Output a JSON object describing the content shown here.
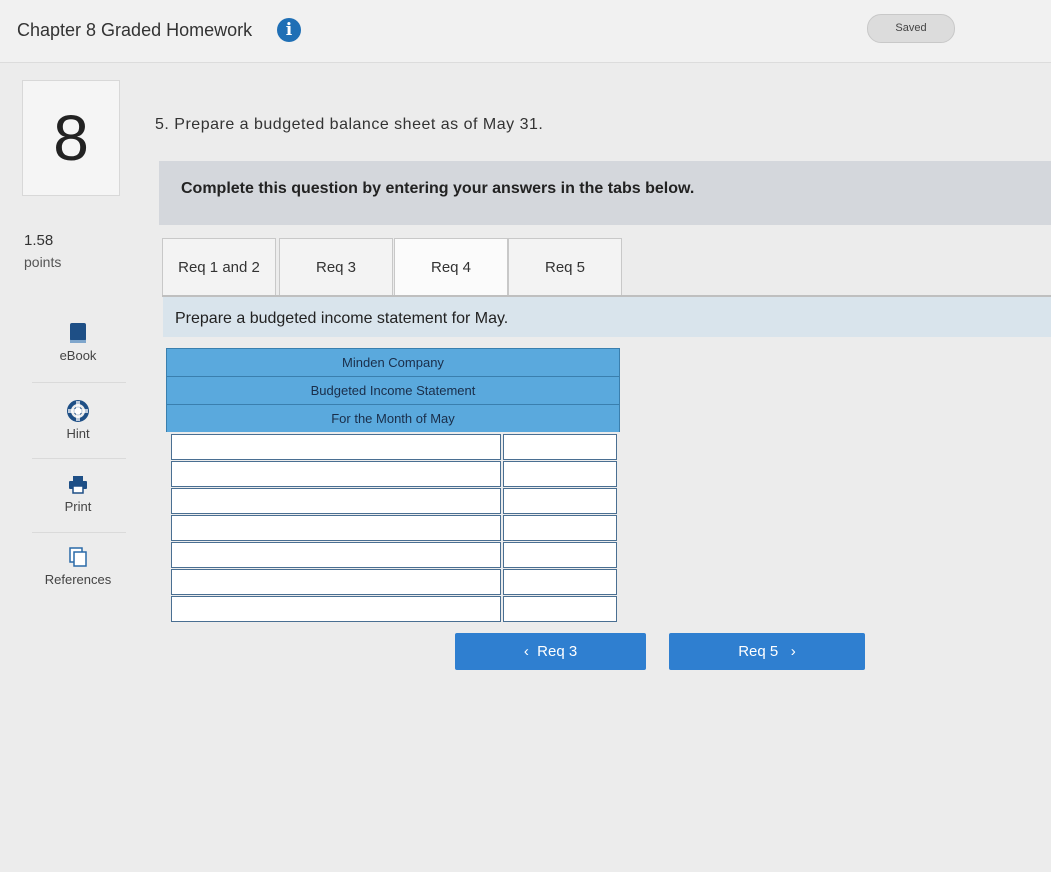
{
  "header": {
    "title": "Chapter 8 Graded Homework",
    "info_icon": "i",
    "saved_label": "Saved"
  },
  "question": {
    "number": "8",
    "points_value": "1.58",
    "points_label": "points"
  },
  "tools": [
    {
      "label": "eBook",
      "icon": "book-icon"
    },
    {
      "label": "Hint",
      "icon": "lifebuoy-icon"
    },
    {
      "label": "Print",
      "icon": "printer-icon"
    },
    {
      "label": "References",
      "icon": "documents-icon"
    }
  ],
  "prompt": "5. Prepare a budgeted balance sheet as of May 31.",
  "instruction": "Complete this question by entering your answers in the tabs below.",
  "tabs": [
    {
      "label": "Req 1 and 2",
      "active": false
    },
    {
      "label": "Req 3",
      "active": false
    },
    {
      "label": "Req 4",
      "active": true
    },
    {
      "label": "Req 5",
      "active": false
    }
  ],
  "subinstruction": "Prepare a budgeted income statement for May.",
  "statement": {
    "company": "Minden Company",
    "title": "Budgeted Income Statement",
    "period": "For the Month of May",
    "rows": [
      {
        "label": "",
        "amount": ""
      },
      {
        "label": "",
        "amount": ""
      },
      {
        "label": "",
        "amount": ""
      },
      {
        "label": "",
        "amount": ""
      },
      {
        "label": "",
        "amount": ""
      },
      {
        "label": "",
        "amount": ""
      },
      {
        "label": "",
        "amount": ""
      }
    ]
  },
  "nav": {
    "prev_label": "Req 3",
    "next_label": "Req 5"
  },
  "colors": {
    "header_blue": "#5aa9dd",
    "button_blue": "#2f7fd0",
    "info_blue": "#1f6fb5"
  }
}
